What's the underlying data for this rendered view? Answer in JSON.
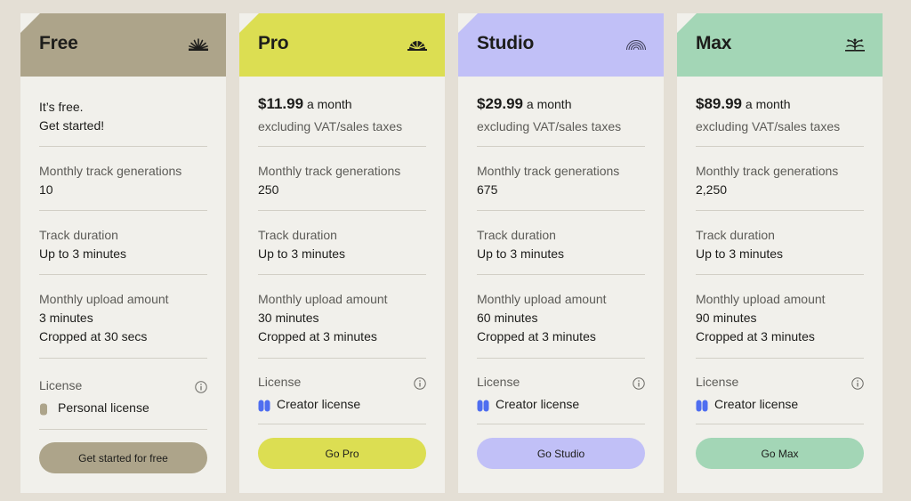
{
  "colors": {
    "free": "#ada48a",
    "pro": "#dcde52",
    "studio": "#c1c0f7",
    "max": "#a3d6b6",
    "license_badge_free": "#ada48a",
    "license_badge_paid": "#4f6ef0"
  },
  "plans": [
    {
      "name": "Free",
      "icon": "fan-sun-icon",
      "intro_line1": "It’s free.",
      "intro_line2": "Get started!",
      "generations_label": "Monthly track generations",
      "generations_value": "10",
      "duration_label": "Track duration",
      "duration_value": "Up to 3 minutes",
      "upload_label": "Monthly upload amount",
      "upload_value": "3 minutes",
      "upload_crop": "Cropped at 30 secs",
      "license_label": "License",
      "license_value": "Personal license",
      "cta": "Get started for free"
    },
    {
      "name": "Pro",
      "icon": "sunrise-icon",
      "price": "$11.99",
      "price_unit": "a month",
      "price_note": "excluding VAT/sales taxes",
      "generations_label": "Monthly track generations",
      "generations_value": "250",
      "duration_label": "Track duration",
      "duration_value": "Up to 3 minutes",
      "upload_label": "Monthly upload amount",
      "upload_value": "30 minutes",
      "upload_crop": "Cropped at 3 minutes",
      "license_label": "License",
      "license_value": "Creator license",
      "cta": "Go Pro"
    },
    {
      "name": "Studio",
      "icon": "rainbow-icon",
      "price": "$29.99",
      "price_unit": "a month",
      "price_note": "excluding VAT/sales taxes",
      "generations_label": "Monthly track generations",
      "generations_value": "675",
      "duration_label": "Track duration",
      "duration_value": "Up to 3 minutes",
      "upload_label": "Monthly upload amount",
      "upload_value": "60 minutes",
      "upload_crop": "Cropped at 3 minutes",
      "license_label": "License",
      "license_value": "Creator license",
      "cta": "Go Studio"
    },
    {
      "name": "Max",
      "icon": "fireworks-icon",
      "price": "$89.99",
      "price_unit": "a month",
      "price_note": "excluding VAT/sales taxes",
      "generations_label": "Monthly track generations",
      "generations_value": "2,250",
      "duration_label": "Track duration",
      "duration_value": "Up to 3 minutes",
      "upload_label": "Monthly upload amount",
      "upload_value": "90 minutes",
      "upload_crop": "Cropped at 3 minutes",
      "license_label": "License",
      "license_value": "Creator license",
      "cta": "Go Max"
    }
  ]
}
